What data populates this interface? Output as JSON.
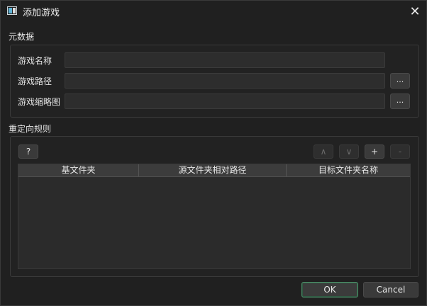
{
  "window": {
    "title": "添加游戏",
    "close_icon_glyph": "✕"
  },
  "metadata": {
    "section_label": "元数据",
    "fields": [
      {
        "label": "游戏名称",
        "value": "",
        "browse_label": ""
      },
      {
        "label": "游戏路径",
        "value": "",
        "browse_label": "..."
      },
      {
        "label": "游戏缩略图",
        "value": "",
        "browse_label": "..."
      }
    ]
  },
  "redirect": {
    "section_label": "重定向规则",
    "help_label": "?",
    "up_label": "∧",
    "down_label": "∨",
    "add_label": "+",
    "remove_label": "-",
    "columns": [
      "基文件夹",
      "源文件夹相对路径",
      "目标文件夹名称"
    ],
    "rows": []
  },
  "footer": {
    "ok_label": "OK",
    "cancel_label": "Cancel"
  },
  "colors": {
    "background": "#202020",
    "ok_border": "#4f8f6a"
  }
}
